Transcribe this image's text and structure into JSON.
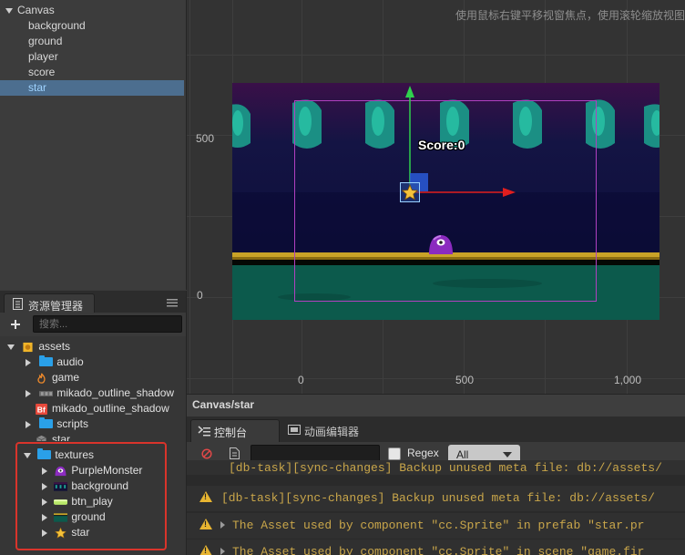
{
  "hierarchy": {
    "nodes": [
      {
        "label": "Canvas"
      },
      {
        "label": "background"
      },
      {
        "label": "ground"
      },
      {
        "label": "player"
      },
      {
        "label": "score"
      },
      {
        "label": "star"
      }
    ]
  },
  "assets": {
    "tab_label": "资源管理器",
    "search_placeholder": "搜索...",
    "tree": [
      {
        "label": "assets"
      },
      {
        "label": "audio"
      },
      {
        "label": "game"
      },
      {
        "label": "mikado_outline_shadow"
      },
      {
        "label": "mikado_outline_shadow"
      },
      {
        "label": "scripts"
      },
      {
        "label": "star"
      },
      {
        "label": "textures"
      },
      {
        "label": "PurpleMonster"
      },
      {
        "label": "background"
      },
      {
        "label": "btn_play"
      },
      {
        "label": "ground"
      },
      {
        "label": "star"
      }
    ],
    "highlight_color": "#d9342b"
  },
  "scene": {
    "hint": "使用鼠标右键平移视窗焦点，使用滚轮缩放视图",
    "y_ticks": [
      "500",
      "0"
    ],
    "x_ticks": [
      "0",
      "500",
      "1,000"
    ],
    "score_label": "Score:0"
  },
  "status_bar": {
    "path": "Canvas/star"
  },
  "console": {
    "tabs": [
      "控制台",
      "动画编辑器"
    ],
    "regex_label": "Regex",
    "level_value": "All",
    "lines": [
      "[db-task][sync-changes] Backup unused meta file: db://assets/",
      "[db-task][sync-changes] Backup unused meta file: db://assets/",
      "The Asset used by component \"cc.Sprite\" in prefab \"star.pr",
      "The Asset used by component \"cc.Sprite\" in scene \"game.fir"
    ]
  },
  "colors": {
    "selection": "#4c6e8f",
    "warning": "#c9a64a",
    "game_sky": "#1a1a44",
    "ground_teal": "#0c5a4c"
  }
}
